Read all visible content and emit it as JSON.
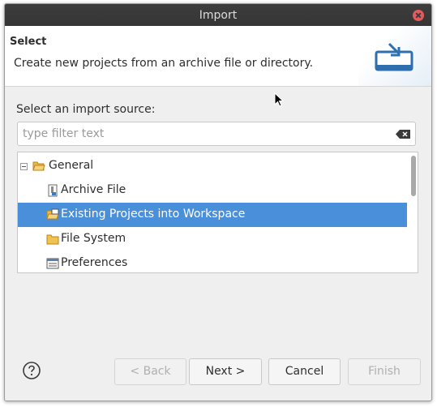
{
  "window": {
    "title": "Import"
  },
  "header": {
    "title": "Select",
    "description": "Create new projects from an archive file or directory."
  },
  "source": {
    "label": "Select an import source:",
    "filter_placeholder": "type filter text",
    "filter_value": ""
  },
  "tree": {
    "items": [
      {
        "label": "General",
        "icon": "folder-open-icon",
        "expanded": true,
        "level": 0
      },
      {
        "label": "Archive File",
        "icon": "archive-file-icon",
        "level": 1
      },
      {
        "label": "Existing Projects into Workspace",
        "icon": "projects-folder-icon",
        "level": 1,
        "selected": true
      },
      {
        "label": "File System",
        "icon": "folder-icon",
        "level": 1
      },
      {
        "label": "Preferences",
        "icon": "preferences-icon",
        "level": 1
      }
    ]
  },
  "buttons": {
    "back": "< Back",
    "next": "Next >",
    "cancel": "Cancel",
    "finish": "Finish"
  },
  "colors": {
    "selection": "#4a8fd9",
    "titlebar": "#3a3a3a",
    "close": "#e35b5b"
  }
}
